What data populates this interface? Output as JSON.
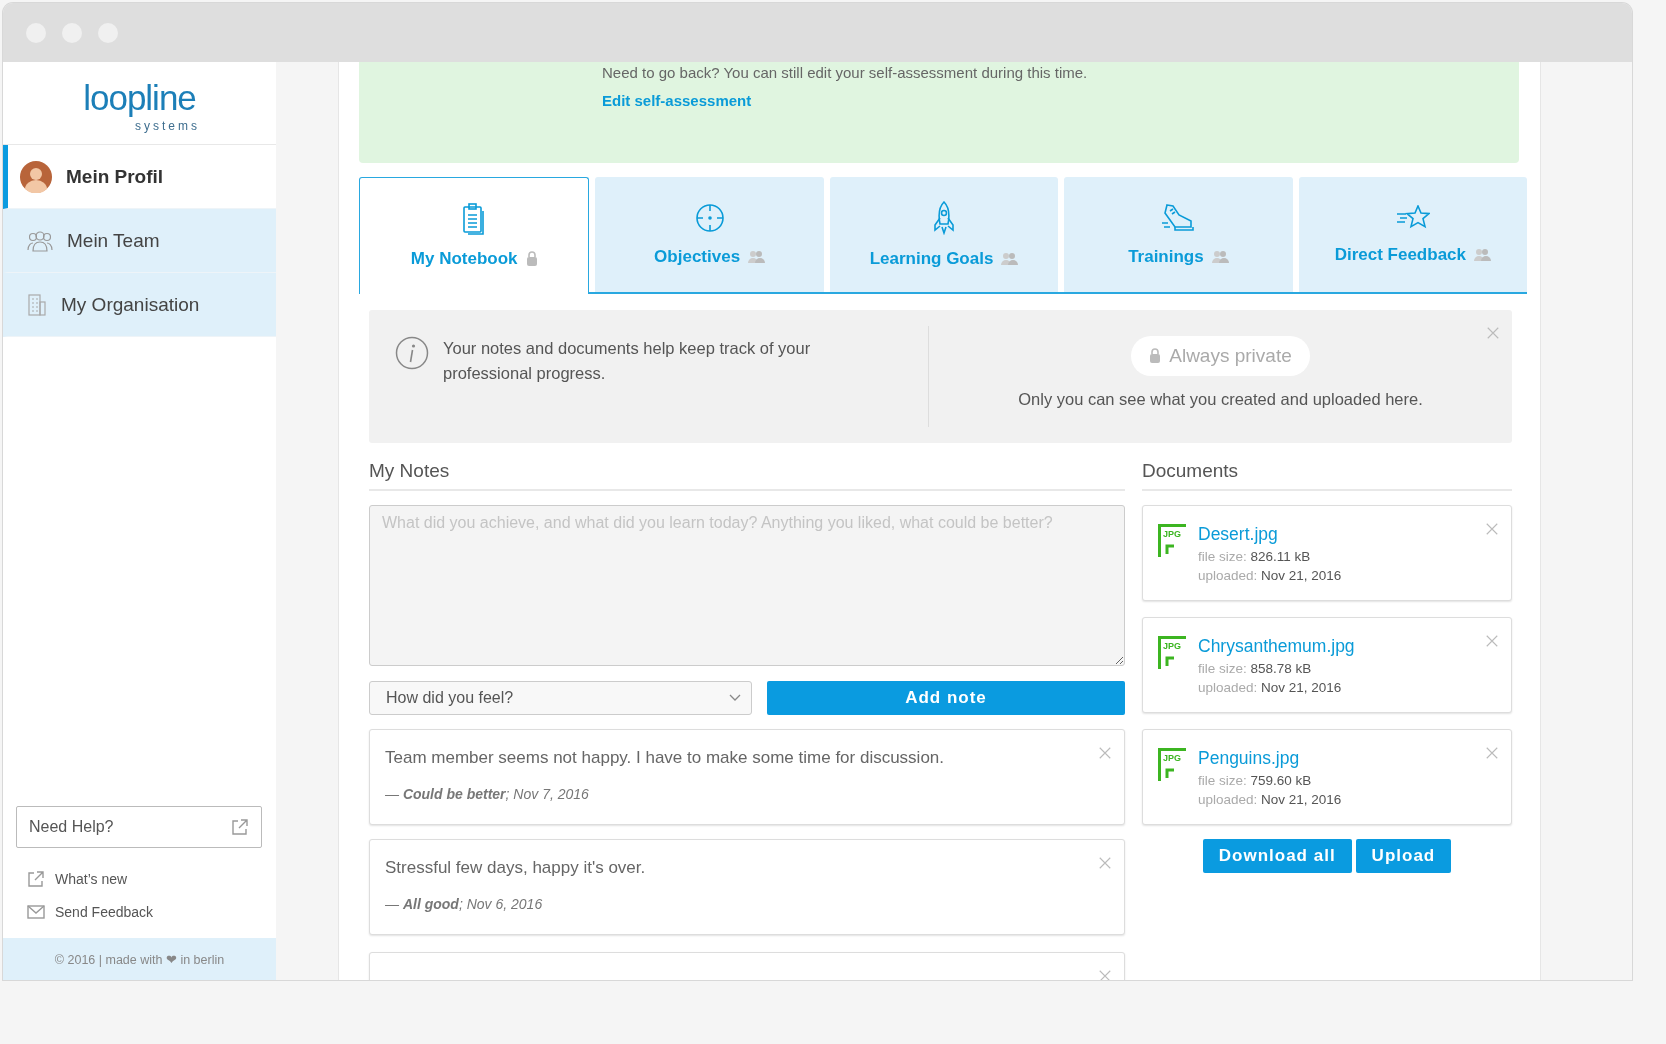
{
  "logo": {
    "name": "loopline",
    "sub": "systems"
  },
  "sidebar": {
    "items": [
      {
        "label": "Mein Profil",
        "kind": "avatar",
        "selected": true
      },
      {
        "label": "Mein Team",
        "kind": "team",
        "selected": false
      },
      {
        "label": "My Organisation",
        "kind": "building",
        "selected": false
      }
    ],
    "help": "Need Help?",
    "links": [
      {
        "label": "What’s new",
        "kind": "external"
      },
      {
        "label": "Send Feedback",
        "kind": "mail"
      }
    ],
    "footer": "© 2016 | made with ❤ in berlin"
  },
  "banner": {
    "text": "Need to go back? You can still edit your self-assessment during this time.",
    "link": "Edit self-assessment"
  },
  "tabs": [
    {
      "label": "My Notebook",
      "kind": "notebook",
      "private": true,
      "selected": true
    },
    {
      "label": "Objectives",
      "kind": "target",
      "private": false,
      "selected": false
    },
    {
      "label": "Learning Goals",
      "kind": "rocket",
      "private": false,
      "selected": false
    },
    {
      "label": "Trainings",
      "kind": "shoe",
      "private": false,
      "selected": false
    },
    {
      "label": "Direct Feedback",
      "kind": "star",
      "private": false,
      "selected": false
    }
  ],
  "info": {
    "text": "Your notes and documents help keep track of your professional progress.",
    "badge": "Always private",
    "note": "Only you can see what you created and uploaded here."
  },
  "notes": {
    "title": "My Notes",
    "placeholder": "What did you achieve, and what did you learn today? Anything you liked, what could be better?",
    "mood_placeholder": "How did you feel?",
    "add_button": "Add note",
    "more_below": true,
    "items": [
      {
        "text": "Team member seems not happy. I have to make some time for discussion.",
        "meta": "— **Could be better**; Nov 7, 2016"
      },
      {
        "text": "Stressful few days, happy it's over.",
        "meta": "— **All good**; Nov 6, 2016"
      }
    ]
  },
  "documents": {
    "title": "Documents",
    "items": [
      {
        "badge": "JPG",
        "name": "Desert.jpg",
        "size_label": "file size:",
        "size": "826.11 kB",
        "uploaded_label": "uploaded:",
        "uploaded": "Nov 21, 2016"
      },
      {
        "badge": "JPG",
        "name": "Chrysanthemum.jpg",
        "size_label": "file size:",
        "size": "858.78 kB",
        "uploaded_label": "uploaded:",
        "uploaded": "Nov 21, 2016"
      },
      {
        "badge": "JPG",
        "name": "Penguins.jpg",
        "size_label": "file size:",
        "size": "759.60 kB",
        "uploaded_label": "uploaded:",
        "uploaded": "Nov 21, 2016"
      }
    ],
    "buttons": [
      "Download all",
      "Upload"
    ]
  }
}
